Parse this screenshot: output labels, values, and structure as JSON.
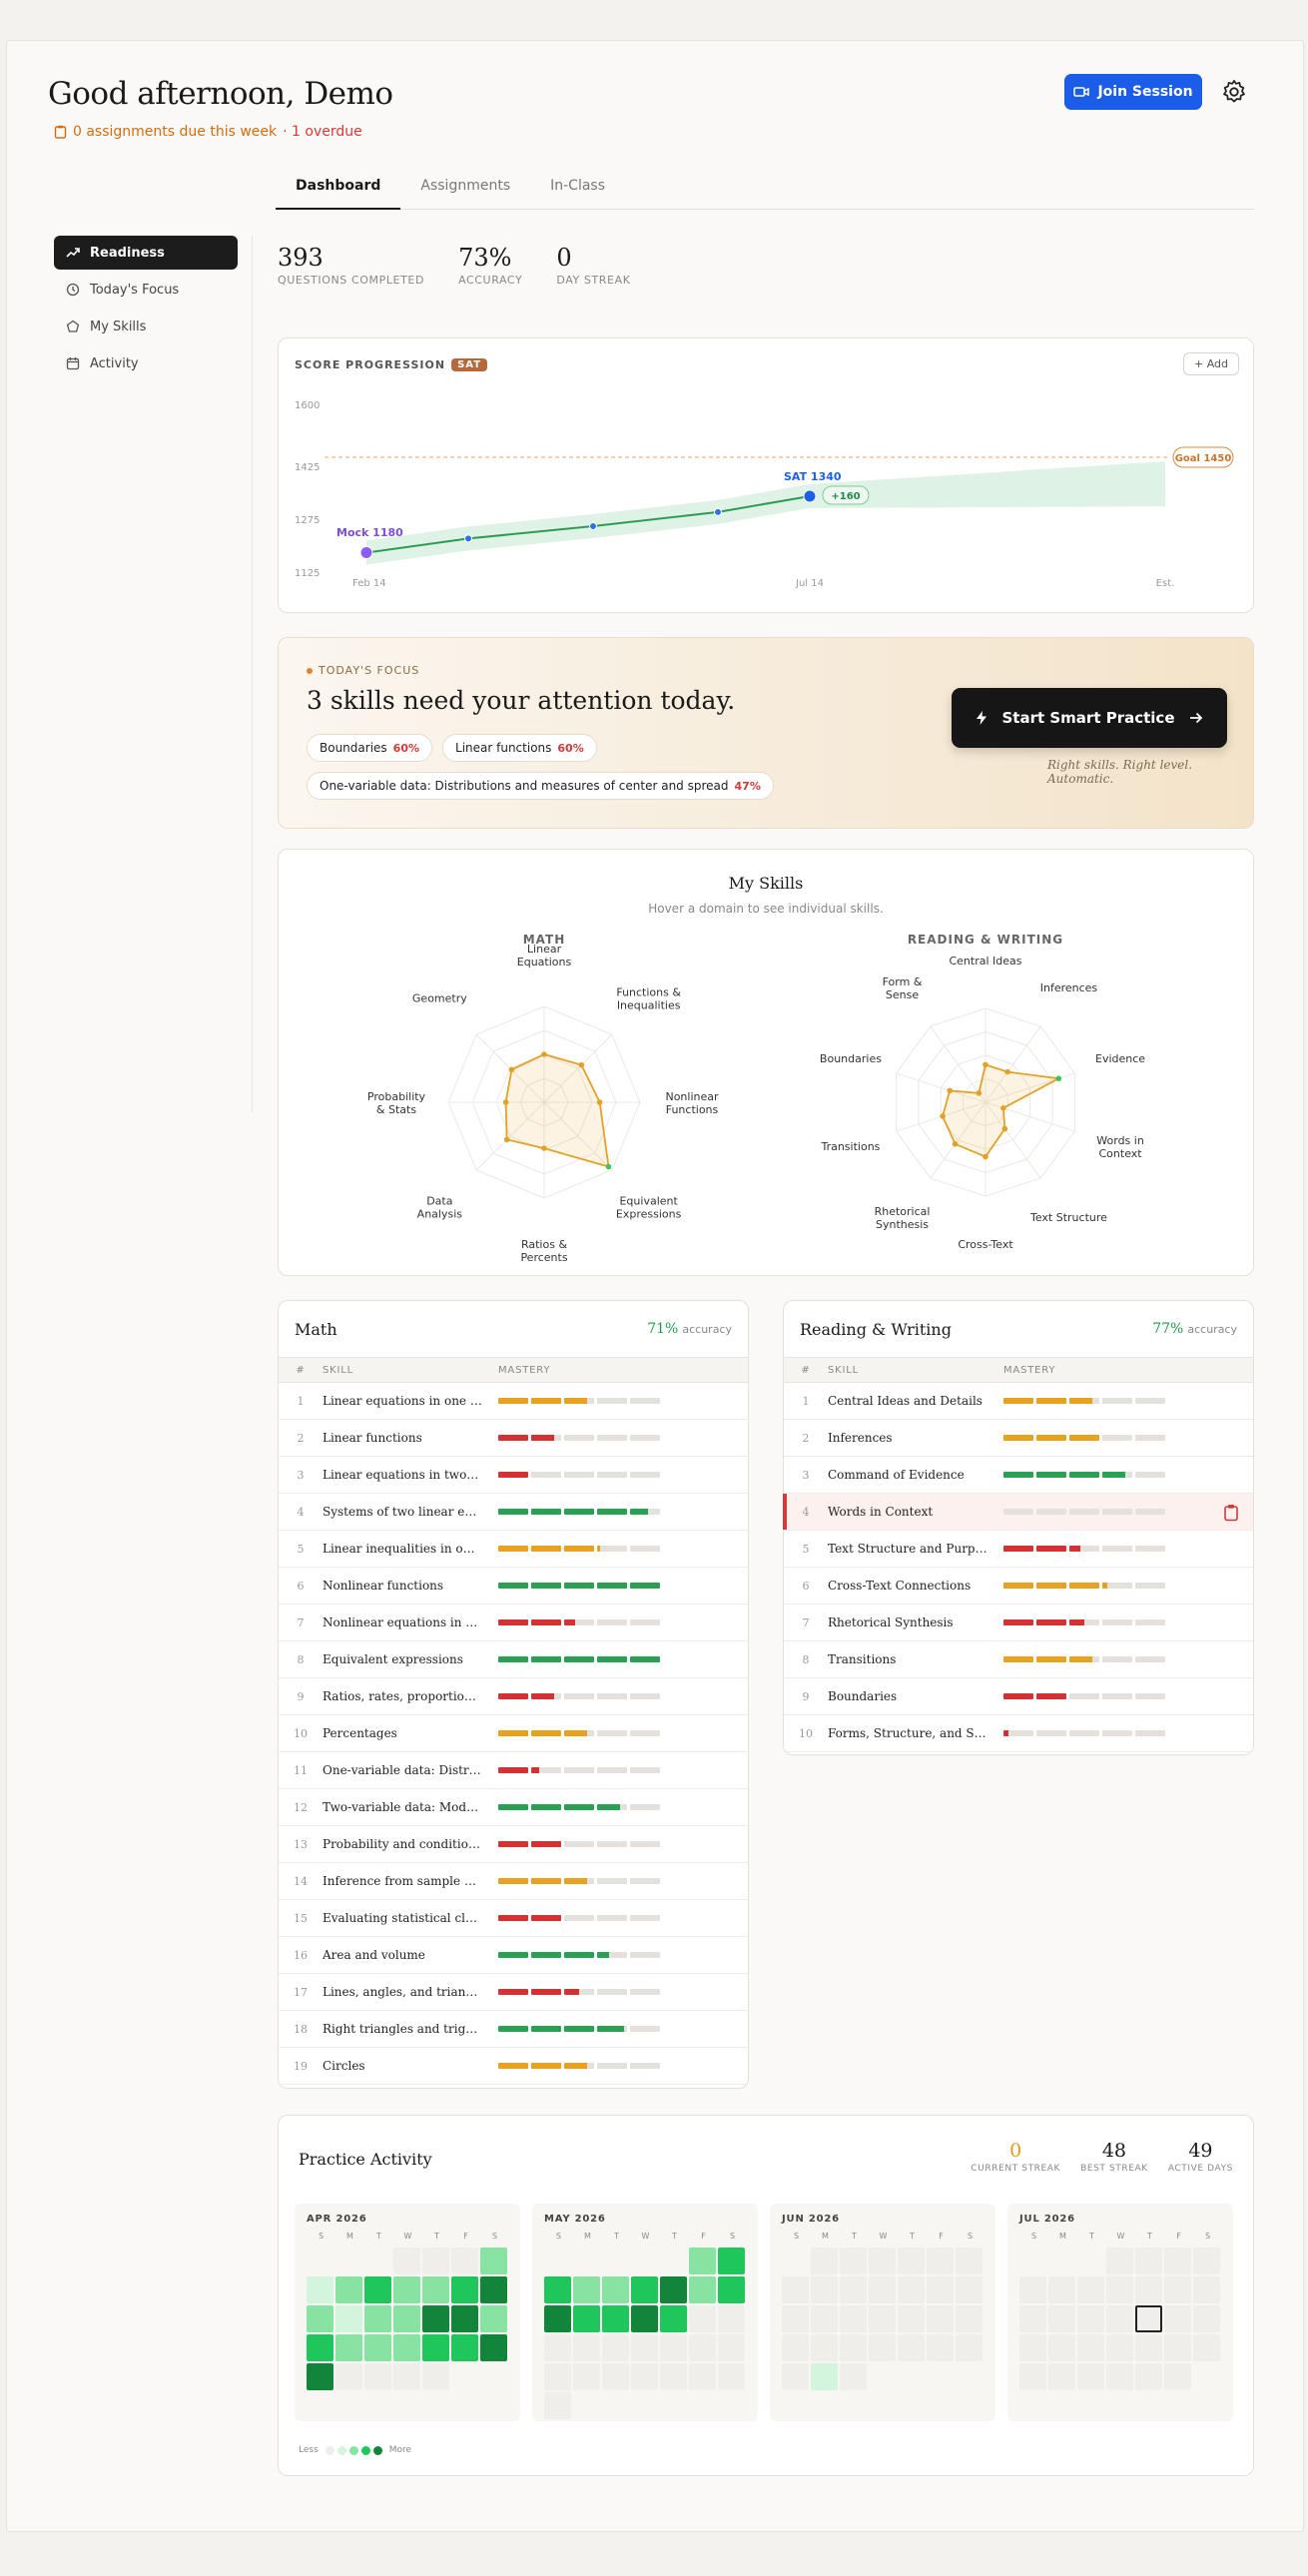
{
  "header": {
    "greeting": "Good afternoon, Demo",
    "due": "0 assignments due this week",
    "overdue": "· 1 overdue",
    "join_label": "Join Session"
  },
  "tabs": [
    "Dashboard",
    "Assignments",
    "In-Class"
  ],
  "sidebar": [
    "Readiness",
    "Today's Focus",
    "My Skills",
    "Activity"
  ],
  "stats": [
    {
      "value": "393",
      "label": "QUESTIONS COMPLETED"
    },
    {
      "value": "73%",
      "label": "ACCURACY"
    },
    {
      "value": "0",
      "label": "DAY STREAK"
    }
  ],
  "score": {
    "title": "SCORE PROGRESSION",
    "badge": "SAT",
    "add": "+ Add",
    "chart_data": {
      "type": "line",
      "y_ticks": [
        "1600",
        "1425",
        "1275",
        "1125"
      ],
      "x_ticks": [
        "Feb 14",
        "Jul 14",
        "Est."
      ],
      "points": [
        1180,
        1220,
        1255,
        1295,
        1340
      ],
      "projection": {
        "end_low": 1300,
        "end_high": 1450
      },
      "goal": 1450,
      "start_label": "Mock 1180",
      "end_label": "SAT 1340",
      "delta": "+160",
      "goal_label": "Goal 1450"
    }
  },
  "focus": {
    "tag": "TODAY'S FOCUS",
    "heading": "3 skills need your attention today.",
    "chips": [
      {
        "name": "Boundaries",
        "pct": "60%"
      },
      {
        "name": "Linear functions",
        "pct": "60%"
      },
      {
        "name": "One-variable data: Distributions and measures of center and spread",
        "pct": "47%"
      }
    ],
    "cta": "Start Smart Practice",
    "tagline": "Right skills. Right level. Automatic."
  },
  "skills": {
    "title": "My Skills",
    "subtitle": "Hover a domain to see individual skills.",
    "math": {
      "title": "MATH",
      "axes": [
        "Linear Equations",
        "Functions & Inequalities",
        "Nonlinear Functions",
        "Equivalent Expressions",
        "Ratios & Percents",
        "Data Analysis",
        "Probability & Stats",
        "Geometry"
      ],
      "values": [
        0.5,
        0.55,
        0.58,
        0.95,
        0.48,
        0.55,
        0.4,
        0.48
      ]
    },
    "rw": {
      "title": "READING & WRITING",
      "axes": [
        "Central Ideas",
        "Inferences",
        "Evidence",
        "Words in Context",
        "Text Structure",
        "Cross-Text",
        "Rhetorical Synthesis",
        "Transitions",
        "Boundaries",
        "Form & Sense"
      ],
      "values": [
        0.4,
        0.4,
        0.82,
        0.2,
        0.35,
        0.58,
        0.55,
        0.48,
        0.4,
        0.12
      ]
    }
  },
  "math_table": {
    "title": "Math",
    "accuracy": "71%",
    "accuracy_label": "accuracy",
    "headers": [
      "#",
      "SKILL",
      "MASTERY"
    ],
    "rows": [
      {
        "n": "1",
        "name": "Linear equations in one variable",
        "level": 0.55,
        "color": "orange"
      },
      {
        "n": "2",
        "name": "Linear functions",
        "level": 0.35,
        "color": "red"
      },
      {
        "n": "3",
        "name": "Linear equations in two variables",
        "level": 0.2,
        "color": "red"
      },
      {
        "n": "4",
        "name": "Systems of two linear equations",
        "level": 0.92,
        "color": "green"
      },
      {
        "n": "5",
        "name": "Linear inequalities in one or two variables",
        "level": 0.62,
        "color": "orange"
      },
      {
        "n": "6",
        "name": "Nonlinear functions",
        "level": 1.0,
        "color": "green"
      },
      {
        "n": "7",
        "name": "Nonlinear equations in one variable",
        "level": 0.47,
        "color": "red"
      },
      {
        "n": "8",
        "name": "Equivalent expressions",
        "level": 1.0,
        "color": "green"
      },
      {
        "n": "9",
        "name": "Ratios, rates, proportional relationships",
        "level": 0.35,
        "color": "red"
      },
      {
        "n": "10",
        "name": "Percentages",
        "level": 0.55,
        "color": "orange"
      },
      {
        "n": "11",
        "name": "One-variable data: Distributions",
        "level": 0.25,
        "color": "red"
      },
      {
        "n": "12",
        "name": "Two-variable data: Models and scatterplots",
        "level": 0.75,
        "color": "green"
      },
      {
        "n": "13",
        "name": "Probability and conditional probability",
        "level": 0.4,
        "color": "red"
      },
      {
        "n": "14",
        "name": "Inference from sample statistics",
        "level": 0.55,
        "color": "orange"
      },
      {
        "n": "15",
        "name": "Evaluating statistical claims",
        "level": 0.4,
        "color": "red"
      },
      {
        "n": "16",
        "name": "Area and volume",
        "level": 0.68,
        "color": "green"
      },
      {
        "n": "17",
        "name": "Lines, angles, and triangles",
        "level": 0.5,
        "color": "red"
      },
      {
        "n": "18",
        "name": "Right triangles and trigonometry",
        "level": 0.78,
        "color": "green"
      },
      {
        "n": "19",
        "name": "Circles",
        "level": 0.55,
        "color": "orange"
      }
    ]
  },
  "rw_table": {
    "title": "Reading & Writing",
    "accuracy": "77%",
    "accuracy_label": "accuracy",
    "headers": [
      "#",
      "SKILL",
      "MASTERY"
    ],
    "rows": [
      {
        "n": "1",
        "name": "Central Ideas and Details",
        "level": 0.55,
        "color": "orange"
      },
      {
        "n": "2",
        "name": "Inferences",
        "level": 0.6,
        "color": "orange"
      },
      {
        "n": "3",
        "name": "Command of Evidence",
        "level": 0.75,
        "color": "green"
      },
      {
        "n": "4",
        "name": "Words in Context",
        "level": 0.0,
        "color": "red"
      },
      {
        "n": "5",
        "name": "Text Structure and Purpose",
        "level": 0.47,
        "color": "red"
      },
      {
        "n": "6",
        "name": "Cross-Text Connections",
        "level": 0.63,
        "color": "orange"
      },
      {
        "n": "7",
        "name": "Rhetorical Synthesis",
        "level": 0.5,
        "color": "red"
      },
      {
        "n": "8",
        "name": "Transitions",
        "level": 0.55,
        "color": "orange"
      },
      {
        "n": "9",
        "name": "Boundaries",
        "level": 0.4,
        "color": "red"
      },
      {
        "n": "10",
        "name": "Forms, Structure, and Sense",
        "level": 0.03,
        "color": "red"
      }
    ]
  },
  "activity": {
    "title": "Practice Activity",
    "streaks": [
      {
        "value": "0",
        "label": "CURRENT STREAK"
      },
      {
        "value": "48",
        "label": "BEST STREAK"
      },
      {
        "value": "49",
        "label": "ACTIVE DAYS"
      }
    ],
    "weekdays": [
      "S",
      "M",
      "T",
      "W",
      "T",
      "F",
      "S"
    ],
    "months": [
      {
        "name": "APR 2026",
        "offset": 3,
        "days": [
          0,
          0,
          0,
          2,
          1,
          2,
          3,
          2,
          2,
          3,
          4,
          2,
          1,
          2,
          2,
          4,
          4,
          2,
          3,
          2,
          2,
          2,
          3,
          3,
          4,
          4,
          0,
          0,
          0,
          0
        ]
      },
      {
        "name": "MAY 2026",
        "offset": 5,
        "days": [
          2,
          3,
          3,
          2,
          2,
          3,
          4,
          2,
          3,
          4,
          3,
          3,
          4,
          3,
          0,
          0,
          0,
          0,
          0,
          0,
          0,
          0,
          0,
          0,
          0,
          0,
          0,
          0,
          0,
          0,
          0
        ]
      },
      {
        "name": "JUN 2026",
        "offset": 1,
        "days": [
          0,
          0,
          0,
          0,
          0,
          0,
          0,
          0,
          0,
          0,
          0,
          0,
          0,
          0,
          0,
          0,
          0,
          0,
          0,
          0,
          0,
          0,
          0,
          0,
          0,
          0,
          0,
          0,
          1,
          0
        ]
      },
      {
        "name": "JUL 2026",
        "offset": 3,
        "days": [
          0,
          0,
          0,
          0,
          0,
          0,
          0,
          0,
          0,
          0,
          0,
          0,
          0,
          0,
          0,
          0,
          0,
          0,
          0,
          0,
          0,
          0,
          0,
          0,
          0,
          0,
          0,
          0,
          0,
          0,
          0
        ]
      }
    ],
    "today_index": {
      "month": 3,
      "day": 15
    },
    "legend_less": "Less",
    "legend_more": "More"
  },
  "colors": {
    "green": "#2aa052",
    "orange": "#e9a21f",
    "red": "#d43232",
    "heat": [
      "#efeeeb",
      "#d3f5dd",
      "#86e3a2",
      "#1ec65c",
      "#13853a"
    ]
  }
}
